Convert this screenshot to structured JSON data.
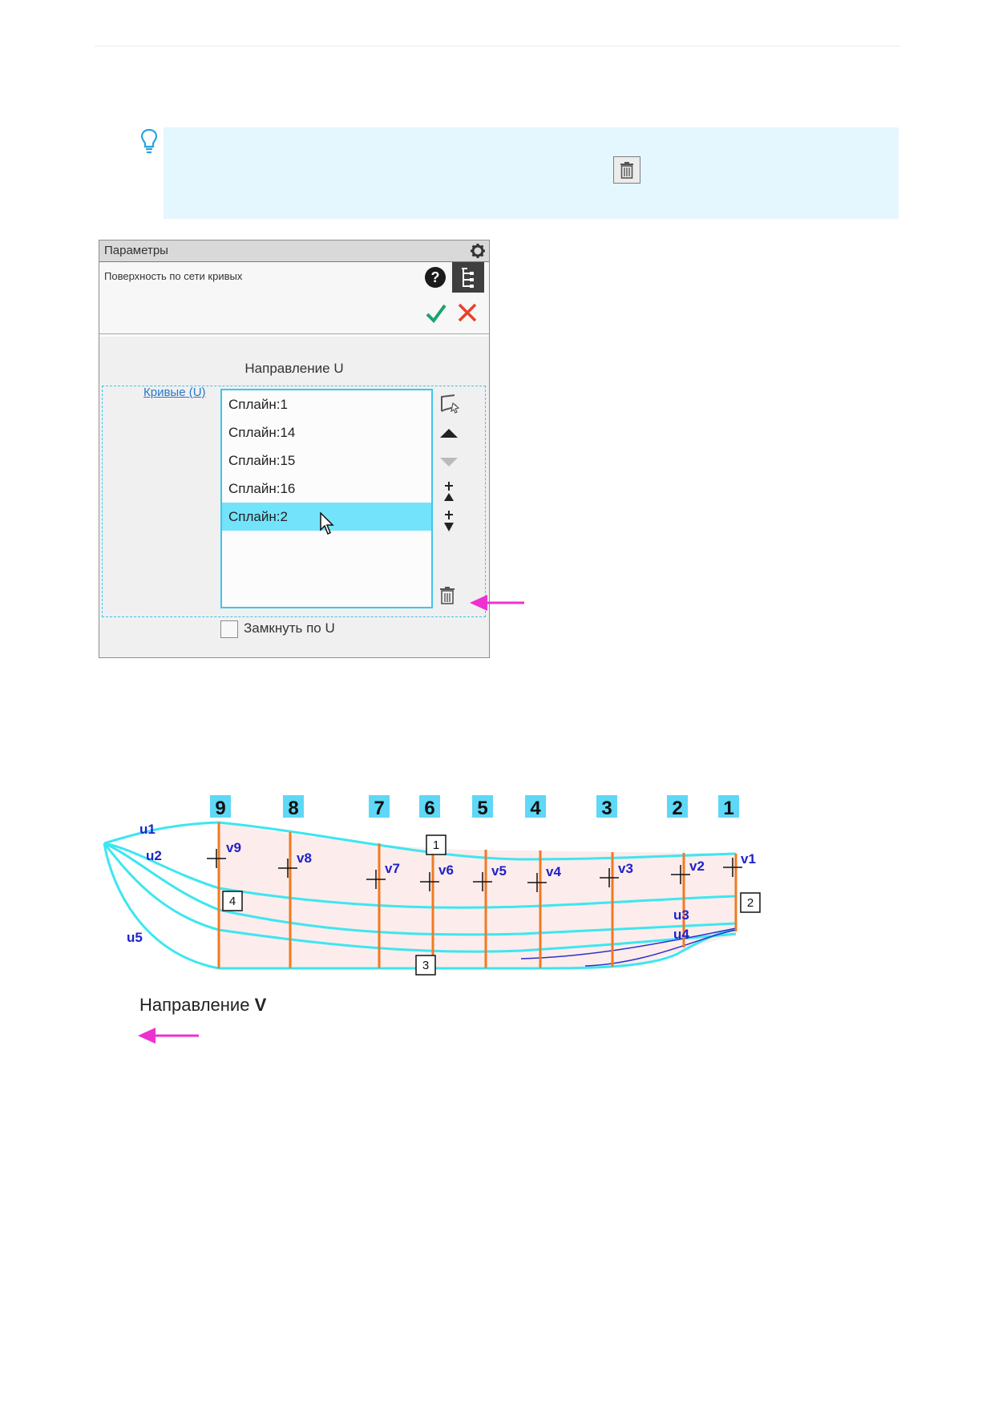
{
  "panel": {
    "title": "Параметры",
    "operation": "Поверхность по сети кривых",
    "direction_label": "Направление U",
    "curves_link": "Кривые (U)",
    "list_items": [
      "Сплайн:1",
      "Сплайн:14",
      "Сплайн:15",
      "Сплайн:16",
      "Сплайн:2"
    ],
    "selected_item": "Сплайн:2",
    "close_checkbox_label": "Замкнуть по U",
    "close_checked": false
  },
  "diagram": {
    "column_numbers": [
      "9",
      "8",
      "7",
      "6",
      "5",
      "4",
      "3",
      "2",
      "1"
    ],
    "v_labels": [
      "v9",
      "v8",
      "v7",
      "v6",
      "v5",
      "v4",
      "v3",
      "v2",
      "v1"
    ],
    "u_labels": [
      "u1",
      "u2",
      "u3",
      "u4",
      "u5"
    ],
    "boundary_labels": [
      "1",
      "2",
      "3",
      "4"
    ],
    "direction_word": "Направление",
    "direction_letter": "V"
  },
  "colors": {
    "tip_background": "#e4f6fe",
    "selection": "#73e3fb",
    "accent_cyan": "#3cc6ee",
    "arrow_magenta": "#ee30d0",
    "v_curve_orange": "#f07a22",
    "u_curve_cyan": "#3de6f0",
    "label_blue": "#1f22c9",
    "ok_green": "#1aa36a",
    "cancel_red": "#e8422a"
  },
  "icons": [
    "lightbulb-icon",
    "trash-icon",
    "gear-icon",
    "help-icon",
    "tree-icon",
    "check-icon",
    "cross-icon",
    "select-curve-icon",
    "move-up-icon",
    "move-down-icon",
    "move-to-top-icon",
    "move-to-bottom-icon",
    "cursor-icon",
    "arrow-left-icon"
  ]
}
